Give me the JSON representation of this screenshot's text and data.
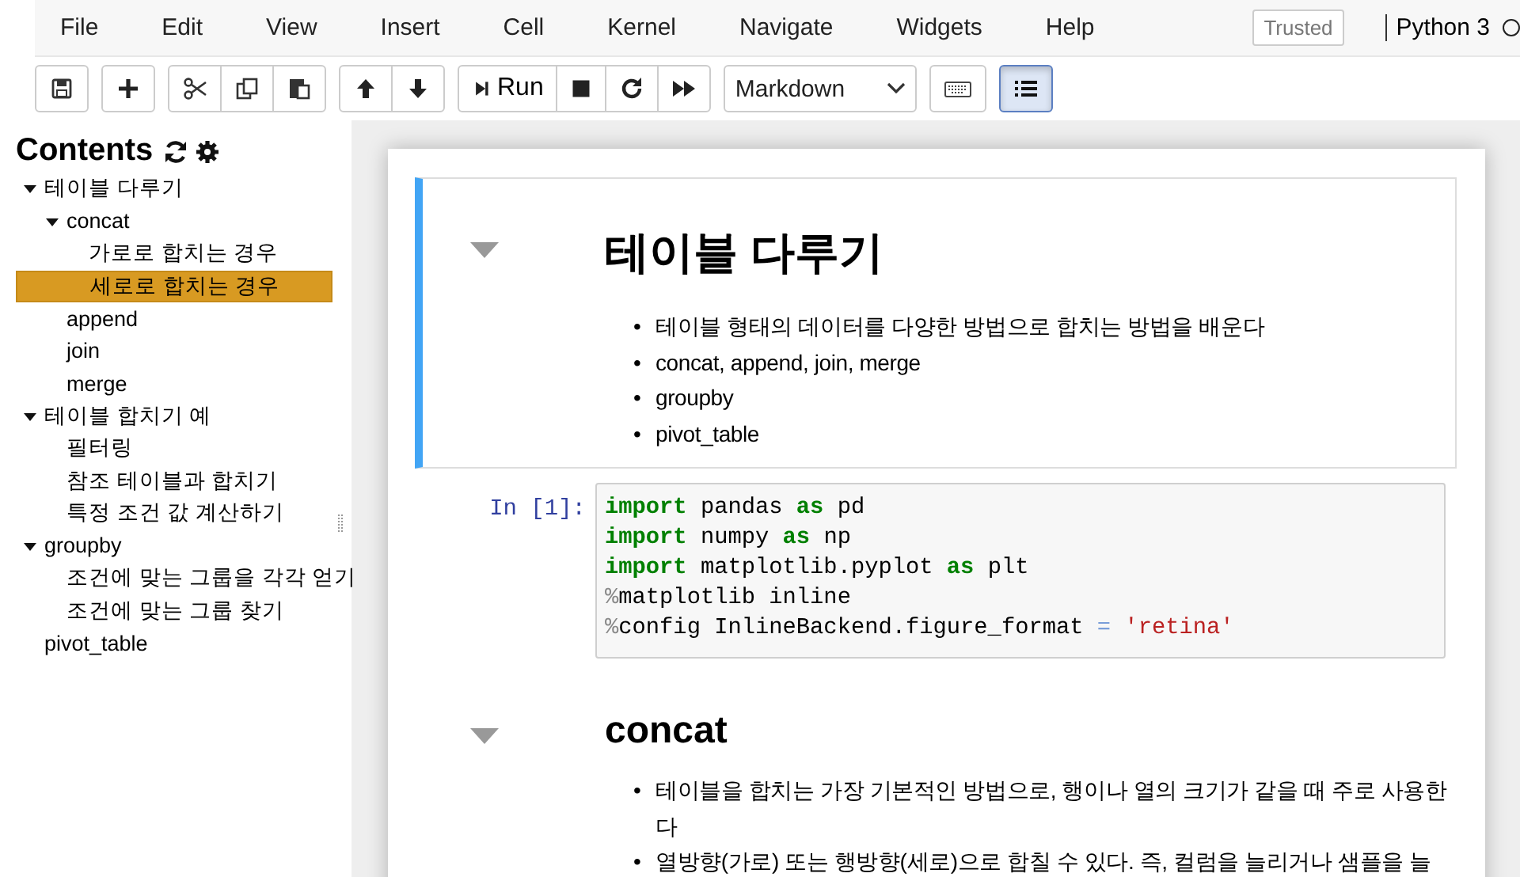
{
  "menu": {
    "items": [
      "File",
      "Edit",
      "View",
      "Insert",
      "Cell",
      "Kernel",
      "Navigate",
      "Widgets",
      "Help"
    ],
    "trusted": "Trusted",
    "kernel": "Python 3"
  },
  "toolbar": {
    "groups": [
      [
        {
          "kind": "save"
        }
      ],
      [
        {
          "kind": "add"
        }
      ],
      [
        {
          "kind": "cut"
        },
        {
          "kind": "copy"
        },
        {
          "kind": "paste"
        }
      ],
      [
        {
          "kind": "up"
        },
        {
          "kind": "down"
        }
      ],
      [
        {
          "kind": "run",
          "label": "Run"
        },
        {
          "kind": "stop"
        },
        {
          "kind": "restart"
        },
        {
          "kind": "fastforward"
        }
      ],
      [
        {
          "kind": "celltype",
          "label": "Markdown"
        }
      ],
      [
        {
          "kind": "keyboard"
        }
      ],
      [
        {
          "kind": "toc",
          "pressed": true
        }
      ]
    ]
  },
  "toc": {
    "title": "Contents",
    "items": [
      {
        "label": "테이블 다루기",
        "expanded": true,
        "selected": false,
        "children": [
          {
            "label": "concat",
            "expanded": true,
            "selected": false,
            "children": [
              {
                "label": "가로로 합치는 경우",
                "selected": false
              },
              {
                "label": "세로로 합치는 경우",
                "selected": true
              }
            ]
          },
          {
            "label": "append",
            "selected": false
          },
          {
            "label": "join",
            "selected": false
          },
          {
            "label": "merge",
            "selected": false
          }
        ]
      },
      {
        "label": "테이블 합치기 예",
        "expanded": true,
        "selected": false,
        "children": [
          {
            "label": "필터링",
            "selected": false
          },
          {
            "label": "참조 테이블과 합치기",
            "selected": false
          },
          {
            "label": "특정 조건 값 계산하기",
            "selected": false
          }
        ]
      },
      {
        "label": "groupby",
        "expanded": true,
        "selected": false,
        "children": [
          {
            "label": "조건에 맞는 그룹을 각각 얻기",
            "selected": false
          },
          {
            "label": "조건에 맞는 그룹 찾기",
            "selected": false
          }
        ]
      },
      {
        "label": "pivot_table",
        "selected": false
      }
    ]
  },
  "cells": [
    {
      "kind": "title",
      "selected": true,
      "heading": "테이블 다루기",
      "bullets": [
        {
          "marker": "•",
          "text": "테이블 형태의 데이터를 다양한 방법으로 합치는 방법을 배운다"
        },
        {
          "marker": "•",
          "text": "concat, append, join, merge"
        },
        {
          "marker": "•",
          "text": "groupby"
        },
        {
          "marker": "•",
          "text": "pivot_table"
        }
      ]
    },
    {
      "kind": "code",
      "selected": false,
      "prompt": "In [1]:",
      "lines": [
        [
          {
            "kind": "keyword",
            "text": "import"
          },
          {
            "kind": "text",
            "text": " pandas "
          },
          {
            "kind": "keyword",
            "text": "as"
          },
          {
            "kind": "text",
            "text": " pd"
          }
        ],
        [
          {
            "kind": "keyword",
            "text": "import"
          },
          {
            "kind": "text",
            "text": " numpy "
          },
          {
            "kind": "keyword",
            "text": "as"
          },
          {
            "kind": "text",
            "text": " np"
          }
        ],
        [
          {
            "kind": "keyword",
            "text": "import"
          },
          {
            "kind": "text",
            "text": " matplotlib.pyplot "
          },
          {
            "kind": "keyword",
            "text": "as"
          },
          {
            "kind": "text",
            "text": " plt"
          }
        ],
        [
          {
            "kind": "magic",
            "text": "%"
          },
          {
            "kind": "text",
            "text": "matplotlib inline"
          }
        ],
        [
          {
            "kind": "magic",
            "text": "%"
          },
          {
            "kind": "text",
            "text": "config InlineBackend.figure_format "
          },
          {
            "kind": "operator",
            "text": "="
          },
          {
            "kind": "string",
            "text": " 'retina'"
          }
        ]
      ]
    },
    {
      "kind": "section",
      "selected": false,
      "heading": "concat",
      "bullets": [
        {
          "marker": "•",
          "text": "테이블을 합치는 가장 기본적인 방법으로, 행이나 열의 크기가 같을 때 주로 사용한다"
        },
        {
          "marker": "•",
          "text": "열방향(가로) 또는 행방향(세로)으로 합칠 수 있다. 즉, 컬럼을 늘리거나 샘플을 늘"
        }
      ]
    }
  ]
}
